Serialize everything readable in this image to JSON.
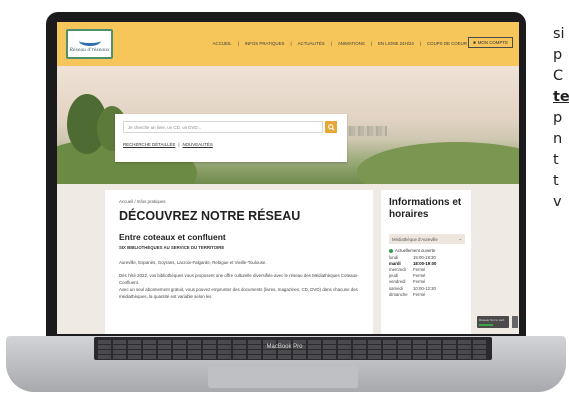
{
  "device": {
    "model_label": "MacBook Pro"
  },
  "site": {
    "logo_text": "Réseau d'réseaux",
    "nav": [
      "ACCUEIL",
      "INFOS PRATIQUES",
      "ACTUALITÉS",
      "ANIMATIONS",
      "EN LIGNE 24H/24",
      "COUPS DE COEUR"
    ],
    "account_label": "MON COMPTE",
    "search": {
      "placeholder": "Je cherche un livre, un CD, un DVD...",
      "advanced_label": "RECHERCHE DÉTAILLÉE",
      "separator": "|",
      "news_label": "NOUVEAUTÉS"
    },
    "breadcrumb": "Accueil / Infos pratiques",
    "page_title": "DÉCOUVREZ NOTRE RÉSEAU",
    "subtitle": "Entre coteaux et confluent",
    "kicker": "SIX BIBLIOTHÈQUES AU SERVICE DU TERRITOIRE",
    "paragraphs": [
      "Aureville, Espanès, Goyrans, Lacroix-Falgarde, Rebigue et Vieille-Toulouse.",
      "Dès l'été 2022, vos bibliothèques vous proposent une offre culturelle diversifiée avec le réseau des Médiathèques Coteaux-Confluent.",
      "Avec un seul abonnement gratuit, vous pouvez emprunter des documents (livres, magazines, CD, DVD) dans chacune des médiathèques, la quantité est variable selon les"
    ],
    "sidebar": {
      "title": "Informations et horaires",
      "selected_library": "Médiathèque d'Aureville",
      "status": "Actuellement ouverte",
      "status_color": "#2aa04a",
      "hours": [
        {
          "day": "lundi",
          "time": "15:00-18:30"
        },
        {
          "day": "mardi",
          "time": "18:00-19:00"
        },
        {
          "day": "mercredi",
          "time": "Fermé"
        },
        {
          "day": "jeudi",
          "time": "Fermé"
        },
        {
          "day": "vendredi",
          "time": "Fermé"
        },
        {
          "day": "samedi",
          "time": "10:00-12:30"
        },
        {
          "day": "dimanche",
          "time": "Fermé"
        }
      ]
    },
    "corner_badge": "Réseau Sur le web",
    "accent_color": "#f6c65b"
  },
  "side_text": {
    "lines": [
      "si",
      "p",
      "C",
      "te",
      "p",
      "n",
      "t",
      "t",
      "v"
    ]
  }
}
